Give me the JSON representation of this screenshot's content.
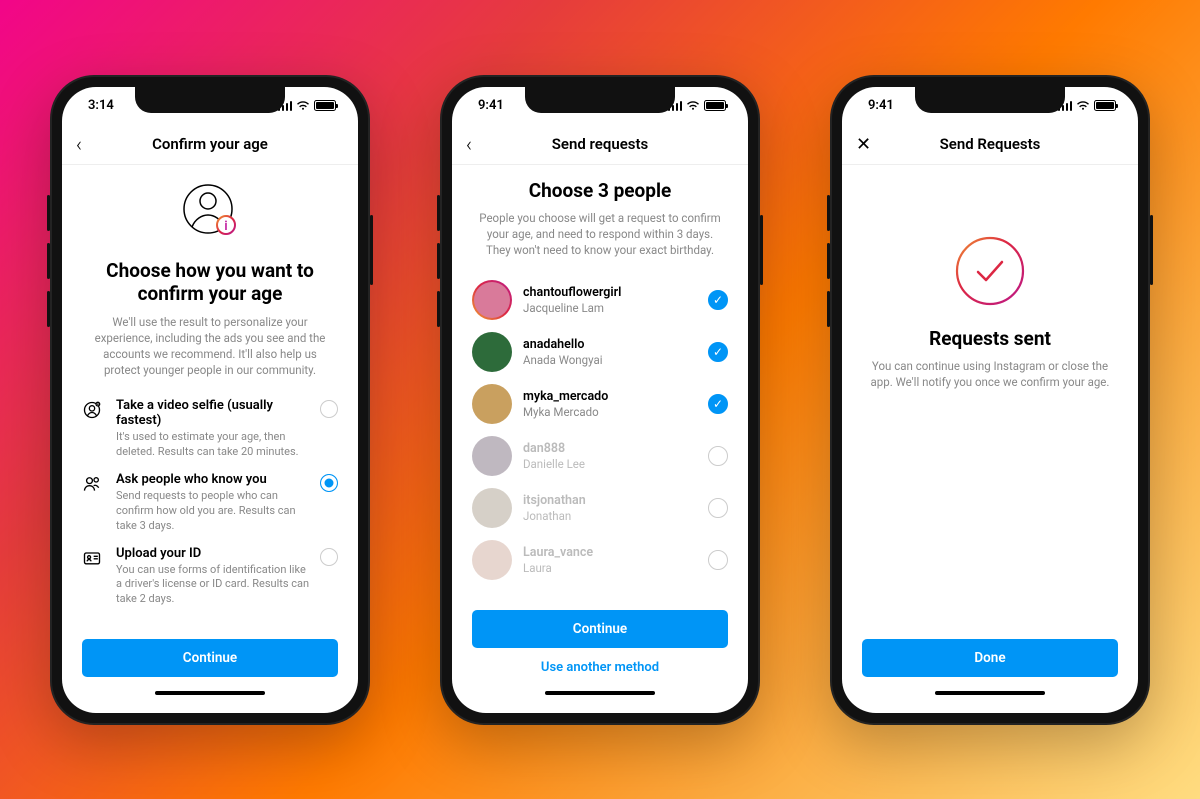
{
  "screen1": {
    "time": "3:14",
    "nav_title": "Confirm your age",
    "hero_title": "Choose how you want to confirm your age",
    "hero_sub": "We'll use the result to personalize your experience, including the ads you see and the accounts we recommend. It'll also help us protect younger people in our community.",
    "options": {
      "selfie_title": "Take a video selfie (usually fastest)",
      "selfie_desc": "It's used to estimate your age, then deleted. Results can take 20 minutes.",
      "ask_title": "Ask people who know you",
      "ask_desc": "Send requests to people who can confirm how old you are. Results can take 3 days.",
      "id_title": "Upload your ID",
      "id_desc": "You can use forms of identification like a driver's license or ID card. Results can take 2 days."
    },
    "continue": "Continue"
  },
  "screen2": {
    "time": "9:41",
    "nav_title": "Send requests",
    "hero_title": "Choose 3 people",
    "hero_sub": "People you choose will get a request to confirm your age, and need to respond within 3 days. They won't need to know your exact birthday.",
    "people": [
      {
        "user": "chantouflowergirl",
        "name": "Jacqueline Lam",
        "selected": true,
        "ring": true,
        "avatar_color": "#d97a9a"
      },
      {
        "user": "anadahello",
        "name": "Anada Wongyai",
        "selected": true,
        "ring": false,
        "avatar_color": "#2d6b3a"
      },
      {
        "user": "myka_mercado",
        "name": "Myka Mercado",
        "selected": true,
        "ring": false,
        "avatar_color": "#c9a05f"
      },
      {
        "user": "dan888",
        "name": "Danielle Lee",
        "selected": false,
        "ring": false,
        "avatar_color": "#8a7d8c"
      },
      {
        "user": "itsjonathan",
        "name": "Jonathan",
        "selected": false,
        "ring": false,
        "avatar_color": "#b5a99a"
      },
      {
        "user": "Laura_vance",
        "name": "Laura",
        "selected": false,
        "ring": false,
        "avatar_color": "#d4b5a8"
      }
    ],
    "continue": "Continue",
    "alt": "Use another method"
  },
  "screen3": {
    "time": "9:41",
    "nav_title": "Send Requests",
    "hero_title": "Requests sent",
    "hero_sub": "You can continue using Instagram or close the app. We'll notify you once we confirm your age.",
    "done": "Done"
  }
}
